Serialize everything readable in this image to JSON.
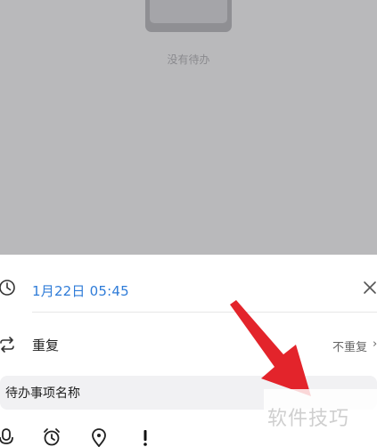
{
  "empty_state": {
    "message": "没有待办"
  },
  "sheet": {
    "date_time": "1月22日 05:45",
    "repeat_label": "重复",
    "repeat_value": "不重复",
    "repeat_chevron": "›",
    "task_name_value": "待办事项名称"
  },
  "icons": {
    "clock": "clock-icon",
    "close": "close-icon",
    "repeat": "repeat-icon",
    "microphone": "microphone-icon",
    "alarm": "alarm-clock-icon",
    "location": "location-pin-icon",
    "priority": "exclamation-icon"
  },
  "watermark": {
    "text": "软件技巧"
  },
  "colors": {
    "accent_blue": "#2f7cd8",
    "overlay_gray": "#b9b9bb",
    "annotation_red": "#e3242b"
  }
}
